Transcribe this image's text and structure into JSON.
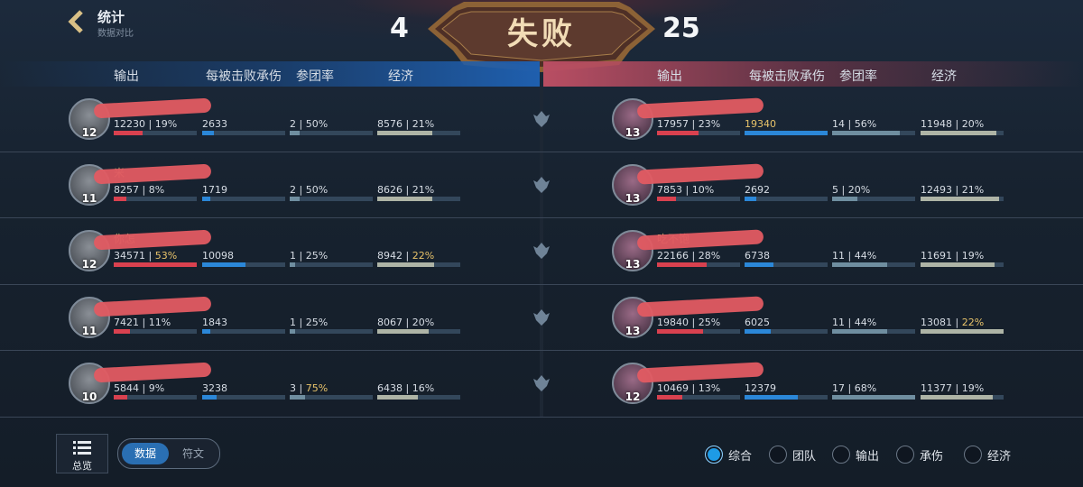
{
  "header": {
    "title": "统计",
    "subtitle": "数据对比",
    "score_left": "4",
    "score_right": "25",
    "result": "失败"
  },
  "columns": {
    "left": [
      "输出",
      "每被击败承伤",
      "参团率",
      "经济"
    ],
    "right": [
      "输出",
      "每被击败承伤",
      "参团率",
      "经济"
    ]
  },
  "left_team": [
    {
      "name": "",
      "level": "12",
      "dmg": "12230",
      "dmg_pct": "19%",
      "dmg_hl": false,
      "dmg_frac": 0.35,
      "taken": "2633",
      "taken_frac": 0.14,
      "kp": "2",
      "kp_pct": "50%",
      "kp_hl": false,
      "kp_frac": 0.12,
      "gold": "8576",
      "gold_pct": "21%",
      "gold_hl": false,
      "gold_frac": 0.66
    },
    {
      "name": "米",
      "level": "11",
      "dmg": "8257",
      "dmg_pct": "8%",
      "dmg_hl": false,
      "dmg_frac": 0.15,
      "taken": "1719",
      "taken_frac": 0.1,
      "kp": "2",
      "kp_pct": "50%",
      "kp_hl": false,
      "kp_frac": 0.12,
      "gold": "8626",
      "gold_pct": "21%",
      "gold_hl": false,
      "gold_frac": 0.66
    },
    {
      "name": "你怎",
      "level": "12",
      "dmg": "34571",
      "dmg_pct": "53%",
      "dmg_hl": true,
      "dmg_frac": 1.0,
      "taken": "10098",
      "taken_frac": 0.52,
      "kp": "1",
      "kp_pct": "25%",
      "kp_hl": false,
      "kp_frac": 0.06,
      "gold": "8942",
      "gold_pct": "22%",
      "gold_hl": true,
      "gold_frac": 0.68
    },
    {
      "name": "",
      "level": "11",
      "dmg": "7421",
      "dmg_pct": "11%",
      "dmg_hl": false,
      "dmg_frac": 0.2,
      "taken": "1843",
      "taken_frac": 0.1,
      "kp": "1",
      "kp_pct": "25%",
      "kp_hl": false,
      "kp_frac": 0.06,
      "gold": "8067",
      "gold_pct": "20%",
      "gold_hl": false,
      "gold_frac": 0.62
    },
    {
      "name": "",
      "level": "10",
      "dmg": "5844",
      "dmg_pct": "9%",
      "dmg_hl": false,
      "dmg_frac": 0.16,
      "taken": "3238",
      "taken_frac": 0.17,
      "kp": "3",
      "kp_pct": "75%",
      "kp_hl": true,
      "kp_frac": 0.18,
      "gold": "6438",
      "gold_pct": "16%",
      "gold_hl": false,
      "gold_frac": 0.49
    }
  ],
  "right_team": [
    {
      "name": "",
      "level": "13",
      "dmg": "17957",
      "dmg_pct": "23%",
      "dmg_hl": false,
      "dmg_frac": 0.5,
      "taken": "19340",
      "taken_hl": true,
      "taken_frac": 1.0,
      "kp": "14",
      "kp_pct": "56%",
      "kp_hl": false,
      "kp_frac": 0.82,
      "gold": "11948",
      "gold_pct": "20%",
      "gold_hl": false,
      "gold_frac": 0.91
    },
    {
      "name": "",
      "level": "13",
      "dmg": "7853",
      "dmg_pct": "10%",
      "dmg_hl": false,
      "dmg_frac": 0.23,
      "taken": "2692",
      "taken_hl": false,
      "taken_frac": 0.14,
      "kp": "5",
      "kp_pct": "20%",
      "kp_hl": false,
      "kp_frac": 0.3,
      "gold": "12493",
      "gold_pct": "21%",
      "gold_hl": false,
      "gold_frac": 0.95
    },
    {
      "name": "吃不饱",
      "level": "13",
      "dmg": "22166",
      "dmg_pct": "28%",
      "dmg_hl": false,
      "dmg_frac": 0.6,
      "taken": "6738",
      "taken_hl": false,
      "taken_frac": 0.35,
      "kp": "11",
      "kp_pct": "44%",
      "kp_hl": false,
      "kp_frac": 0.66,
      "gold": "11691",
      "gold_pct": "19%",
      "gold_hl": false,
      "gold_frac": 0.89
    },
    {
      "name": "",
      "level": "13",
      "dmg": "19840",
      "dmg_pct": "25%",
      "dmg_hl": false,
      "dmg_frac": 0.55,
      "taken": "6025",
      "taken_hl": false,
      "taken_frac": 0.31,
      "kp": "11",
      "kp_pct": "44%",
      "kp_hl": false,
      "kp_frac": 0.66,
      "gold": "13081",
      "gold_pct": "22%",
      "gold_hl": true,
      "gold_frac": 1.0
    },
    {
      "name": "",
      "level": "12",
      "dmg": "10469",
      "dmg_pct": "13%",
      "dmg_hl": false,
      "dmg_frac": 0.3,
      "taken": "12379",
      "taken_hl": false,
      "taken_frac": 0.64,
      "kp": "17",
      "kp_pct": "68%",
      "kp_hl": false,
      "kp_frac": 1.0,
      "gold": "11377",
      "gold_pct": "19%",
      "gold_hl": false,
      "gold_frac": 0.87
    }
  ],
  "lane_icons": [
    "top-lane-icon",
    "jungle-icon",
    "mid-lane-icon",
    "support-icon",
    "adc-lane-icon"
  ],
  "footer": {
    "overview_label": "总览",
    "toggle_on": "数据",
    "toggle_off": "符文",
    "filters": [
      "综合",
      "团队",
      "输出",
      "承伤",
      "经济"
    ],
    "active_filter": 0
  },
  "colors": {
    "blue_team": "#1f5fae",
    "red_team": "#b94e63",
    "highlight": "#e8c36a",
    "damage_bar": "#d9414f",
    "taken_bar": "#2b87d8"
  }
}
